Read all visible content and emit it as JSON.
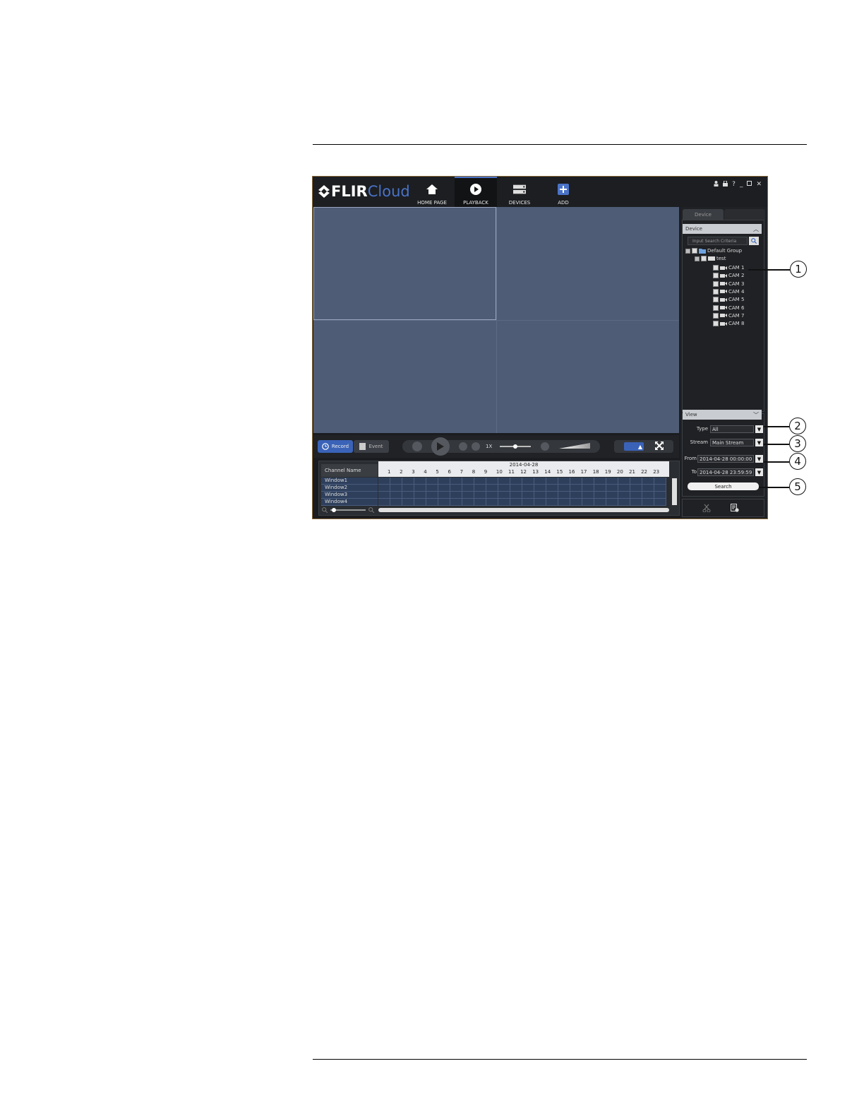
{
  "app": {
    "logo_text_bold": "FLIR",
    "logo_text_light": "Cloud",
    "nav": [
      {
        "label": "HOME PAGE",
        "icon": "home-icon"
      },
      {
        "label": "PLAYBACK",
        "icon": "play-icon"
      },
      {
        "label": "DEVICES",
        "icon": "devices-icon"
      },
      {
        "label": "ADD",
        "icon": "add-icon"
      }
    ],
    "window_controls": {
      "help": "?",
      "minimize": "_",
      "close": "✕"
    }
  },
  "playback_controls": {
    "record_label": "Record",
    "event_label": "Event",
    "speed_label": "1X"
  },
  "timeline": {
    "date": "2014-04-28",
    "channel_header": "Channel Name",
    "hours": [
      "1",
      "2",
      "3",
      "4",
      "5",
      "6",
      "7",
      "8",
      "9",
      "10",
      "11",
      "12",
      "13",
      "14",
      "15",
      "16",
      "17",
      "18",
      "19",
      "20",
      "21",
      "22",
      "23"
    ],
    "channels": [
      "Window1",
      "Window2",
      "Window3",
      "Window4"
    ]
  },
  "right_panel": {
    "tab_device": "Device",
    "device_section": "Device",
    "search_placeholder": "Input Search Criteria",
    "tree": {
      "group": "Default Group",
      "device": "test",
      "cams": [
        "CAM 1",
        "CAM 2",
        "CAM 3",
        "CAM 4",
        "CAM 5",
        "CAM 6",
        "CAM 7",
        "CAM 8"
      ]
    },
    "view_section": "View",
    "type_label": "Type",
    "type_value": "All",
    "stream_label": "Stream",
    "stream_value": "Main Stream",
    "from_label": "From",
    "from_value": "2014-04-28 00:00:00",
    "to_label": "To",
    "to_value": "2014-04-28 23:59:59",
    "search_button": "Search"
  },
  "callouts": [
    "1",
    "2",
    "3",
    "4",
    "5"
  ],
  "colors": {
    "accent": "#4a73c8",
    "video_bg": "#4f5c76",
    "chrome_bg": "#1c1e21"
  }
}
